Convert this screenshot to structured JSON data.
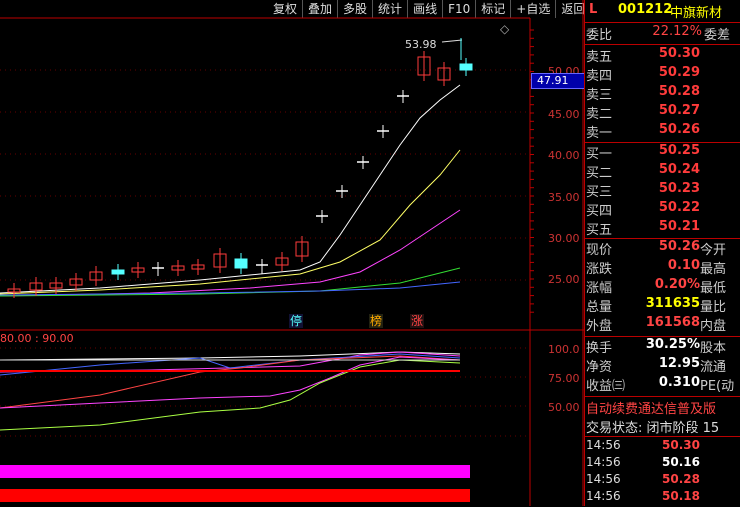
{
  "toolbar": [
    "复权",
    "叠加",
    "多股",
    "统计",
    "画线",
    "F10",
    "标记",
    "+自选",
    "返回"
  ],
  "colors": {
    "up": "#ff3b3b",
    "down": "#55ffff",
    "flat": "#ffffff",
    "ma5": "#ffffff",
    "ma10": "#ffff66",
    "ma20": "#ff44ff",
    "ma60": "#33dd33",
    "ma120": "#4466ff",
    "yellow_val": "#ffff00",
    "axis": "#bb0000",
    "highlight_box": "#0000aa"
  },
  "main_chart": {
    "max_label": "53.98",
    "price_axis": [
      "50.00",
      "45.00",
      "40.00",
      "35.00",
      "30.00",
      "25.00"
    ],
    "current_price_tag": "47.91",
    "markers": [
      {
        "text": "停",
        "color": "#55ffff"
      },
      {
        "text": "榜",
        "color": "#ffaa00"
      },
      {
        "text": "涨",
        "color": "#ff4444"
      }
    ]
  },
  "indicator": {
    "params": "80.00 : 90.00",
    "axis": [
      "100.0",
      "75.00",
      "50.00"
    ]
  },
  "quote": {
    "header": {
      "flag": "L",
      "code": "001212",
      "name": "中旗新材"
    },
    "weibi": {
      "label": "委比",
      "value": "22.12%",
      "sub": "委差"
    },
    "sell": [
      {
        "label": "卖五",
        "price": "50.30"
      },
      {
        "label": "卖四",
        "price": "50.29"
      },
      {
        "label": "卖三",
        "price": "50.28"
      },
      {
        "label": "卖二",
        "price": "50.27"
      },
      {
        "label": "卖一",
        "price": "50.26"
      }
    ],
    "buy": [
      {
        "label": "买一",
        "price": "50.25"
      },
      {
        "label": "买二",
        "price": "50.24"
      },
      {
        "label": "买三",
        "price": "50.23"
      },
      {
        "label": "买四",
        "price": "50.22"
      },
      {
        "label": "买五",
        "price": "50.21"
      }
    ],
    "stats": [
      {
        "label": "现价",
        "value": "50.26",
        "sub": "今开",
        "color": "#ff4444"
      },
      {
        "label": "涨跌",
        "value": "0.10",
        "sub": "最高",
        "color": "#ff4444"
      },
      {
        "label": "涨幅",
        "value": "0.20%",
        "sub": "最低",
        "color": "#ff4444"
      },
      {
        "label": "总量",
        "value": "311635",
        "sub": "量比",
        "color": "#ffff00"
      },
      {
        "label": "外盘",
        "value": "161568",
        "sub": "内盘",
        "color": "#ff4444"
      }
    ],
    "stats2": [
      {
        "label": "换手",
        "value": "30.25%",
        "sub": "股本",
        "color": "#ffffff"
      },
      {
        "label": "净资",
        "value": "12.95",
        "sub": "流通",
        "color": "#ffffff"
      },
      {
        "label": "收益㈢",
        "value": "0.310",
        "sub": "PE(动",
        "color": "#ffffff"
      }
    ],
    "notice": "自动续费通达信普及版",
    "trade_status": "交易状态: 闭市阶段 15",
    "ticks": [
      {
        "time": "14:56",
        "price": "50.30",
        "color": "#ff4444"
      },
      {
        "time": "14:56",
        "price": "50.16",
        "color": "#ffffff"
      },
      {
        "time": "14:56",
        "price": "50.28",
        "color": "#ff4444"
      },
      {
        "time": "14:56",
        "price": "50.18",
        "color": "#ff4444"
      }
    ]
  }
}
